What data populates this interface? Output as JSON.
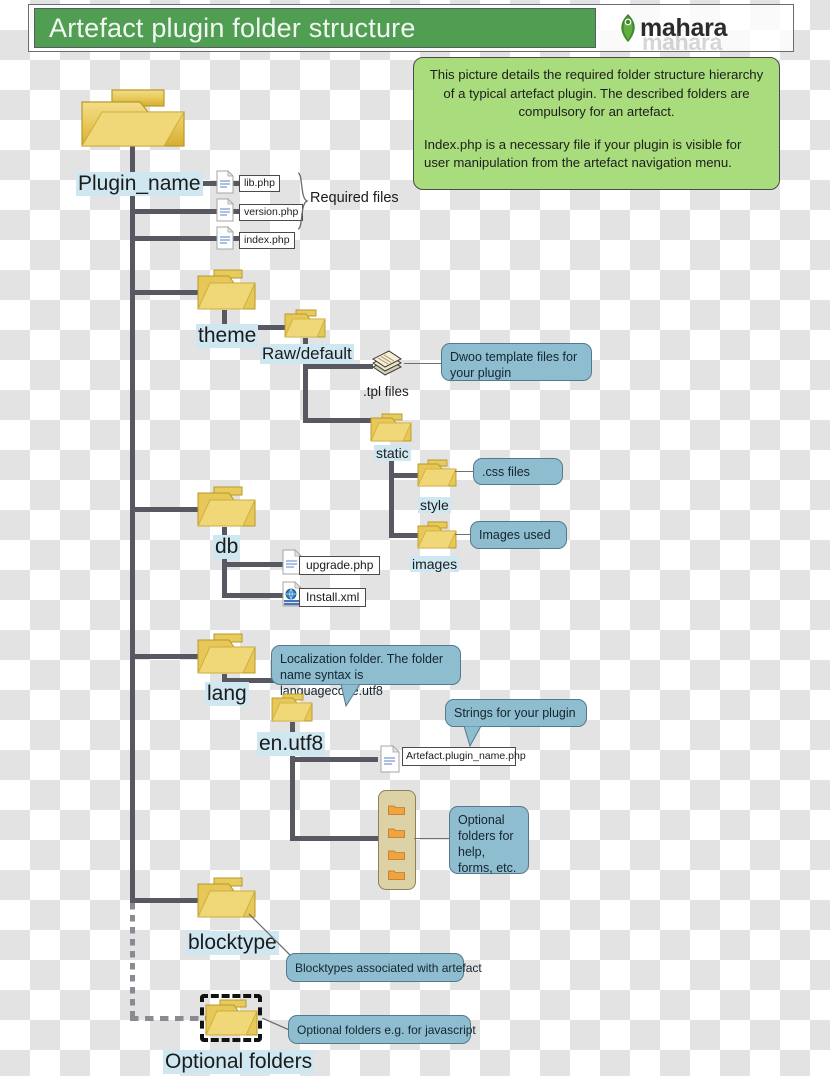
{
  "header": {
    "title": "Artefact plugin  folder structure",
    "logo_text": "mahara",
    "logo_icon": "mahara-leaf-icon"
  },
  "description": {
    "paragraph1": "This picture details the required folder structure hierarchy of a typical artefact plugin. The described folders are compulsory for an artefact.",
    "paragraph2": "Index.php is a necessary file if your plugin is visible for user manipulation from the artefact navigation menu."
  },
  "tree": {
    "root": {
      "label": "Plugin_name",
      "icon": "folder-icon"
    },
    "required_files_label": "Required files",
    "files": [
      {
        "name": "lib.php",
        "icon": "php-file-icon"
      },
      {
        "name": "version.php",
        "icon": "php-file-icon"
      },
      {
        "name": "index.php",
        "icon": "php-file-icon"
      }
    ],
    "folders": [
      {
        "label": "theme",
        "icon": "folder-icon"
      },
      {
        "label": "Raw/default",
        "icon": "folder-icon"
      },
      {
        "label": "static",
        "icon": "folder-icon"
      },
      {
        "label": "style",
        "icon": "folder-icon"
      },
      {
        "label": "images",
        "icon": "folder-icon"
      },
      {
        "label": "db",
        "icon": "folder-icon"
      },
      {
        "label": "lang",
        "icon": "folder-icon"
      },
      {
        "label": "en.utf8",
        "icon": "folder-icon"
      },
      {
        "label": "blocktype",
        "icon": "folder-icon"
      },
      {
        "label": "Optional folders",
        "icon": "folder-dashed-icon"
      }
    ],
    "tpl_files_label": ".tpl files",
    "db_files": [
      {
        "name": "upgrade.php",
        "icon": "php-file-icon"
      },
      {
        "name": "Install.xml",
        "icon": "xml-file-icon"
      }
    ],
    "lang_file": {
      "name": "Artefact.plugin_name.php",
      "icon": "php-file-icon"
    },
    "optional_stack": {
      "icon": "stacked-folders-icon"
    }
  },
  "callouts": {
    "tpl": "Dwoo template files for your plugin",
    "css": ".css files",
    "images": "Images used",
    "lang": "Localization folder. The folder name syntax is languagecode.utf8",
    "strings": "Strings for your plugin",
    "optional_stack": "Optional folders for help, forms, etc.",
    "blocktype": "Blocktypes associated with artefact",
    "optional_folders": "Optional folders e.g. for javascript"
  },
  "colors": {
    "header_green": "#4f9e52",
    "description_green": "#a9dc7c",
    "callout_blue": "#8fbdd0",
    "label_highlight": "#cfe7f0",
    "line_gray": "#585862",
    "folder_yellow": "#e8c95a"
  }
}
